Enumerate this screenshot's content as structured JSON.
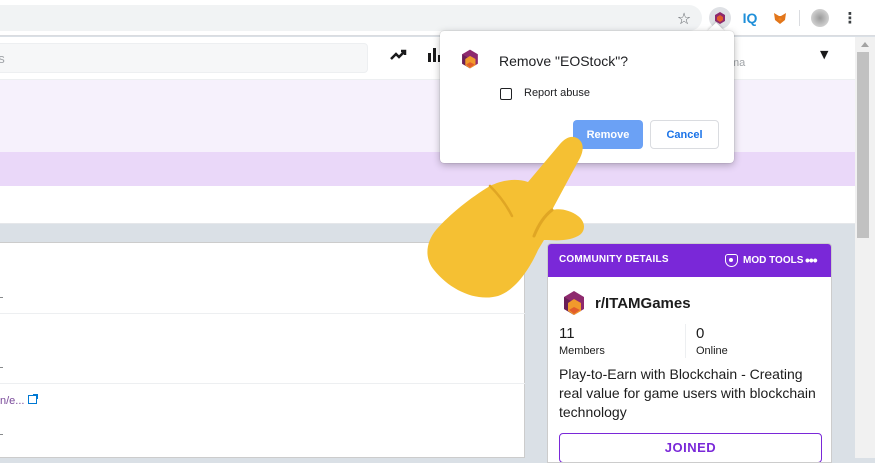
{
  "browser": {
    "toolbar_icons": [
      "star-icon",
      "eostock-extension-icon",
      "iq-extension-icon",
      "metamask-extension-icon",
      "profile-avatar",
      "kebab-menu-icon"
    ],
    "iq_label": "IQ"
  },
  "reddit_header": {
    "search_placeholder_fragment": "es",
    "username_fragment": "ma",
    "icons": [
      "trending-icon",
      "stats-icon",
      "chevron-down-icon"
    ]
  },
  "feed": {
    "link_fragment": "n/e..."
  },
  "popup": {
    "title": "Remove \"EOStock\"?",
    "checkbox_label": "Report abuse",
    "checkbox_checked": false,
    "remove_label": "Remove",
    "cancel_label": "Cancel"
  },
  "community": {
    "header_title": "COMMUNITY DETAILS",
    "mod_tools_label": "MOD TOOLS",
    "more_label": "•••",
    "name": "r/ITAMGames",
    "members_count": "11",
    "members_label": "Members",
    "online_count": "0",
    "online_label": "Online",
    "description": "Play-to-Earn with Blockchain - Creating real value for game users with blockchain technology",
    "joined_label": "JOINED"
  },
  "colors": {
    "accent_purple": "#7a28d8",
    "remove_blue": "#6ba1f5",
    "cancel_blue": "#1a73e8",
    "hand_yellow": "#f5c033"
  }
}
